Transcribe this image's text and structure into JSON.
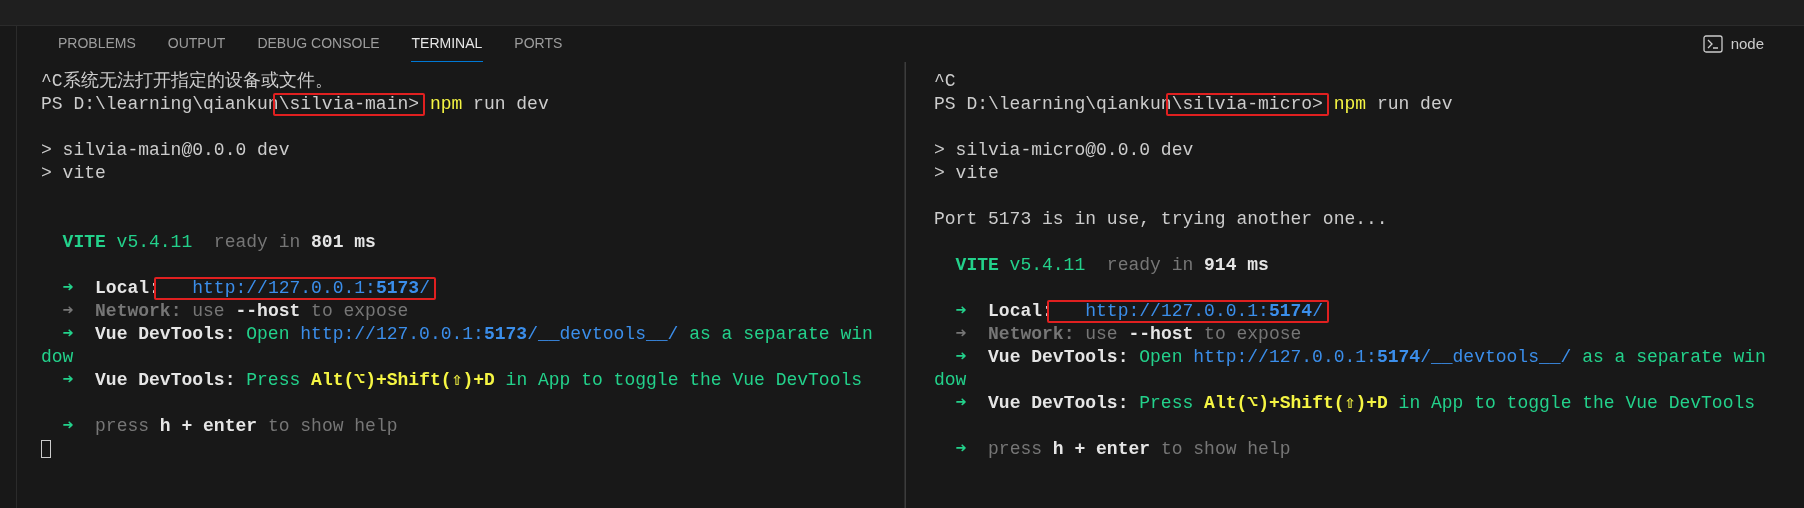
{
  "tabs": [
    {
      "label": "PROBLEMS",
      "selected": false
    },
    {
      "label": "OUTPUT",
      "selected": false
    },
    {
      "label": "DEBUG CONSOLE",
      "selected": false
    },
    {
      "label": "TERMINAL",
      "selected": true
    },
    {
      "label": "PORTS",
      "selected": false
    }
  ],
  "terminal_name": "node",
  "panes": [
    {
      "cursor_visible": true,
      "lines": [
        {
          "kind": "text",
          "segments": [
            {
              "text": "^C系统无法打开指定的设备或文件。",
              "kind": "text"
            }
          ]
        },
        {
          "kind": "text",
          "segments": [
            {
              "text": "PS D:\\learning\\qiankun",
              "kind": "text"
            },
            {
              "text": "\\silvia-main>",
              "kind": "text",
              "highlighted": true
            },
            {
              "text": " npm",
              "kind": "command"
            },
            {
              "text": " run dev",
              "kind": "text"
            }
          ]
        },
        {
          "kind": "blank"
        },
        {
          "kind": "text",
          "segments": [
            {
              "text": "> silvia-main@0.0.0 dev",
              "kind": "text"
            }
          ]
        },
        {
          "kind": "text",
          "segments": [
            {
              "text": "> vite",
              "kind": "text"
            }
          ]
        },
        {
          "kind": "blank"
        },
        {
          "kind": "blank"
        },
        {
          "kind": "indented",
          "segments": [
            {
              "text": "VITE",
              "kind": "accent-strong"
            },
            {
              "text": " v5.4.11",
              "kind": "accent"
            },
            {
              "text": "  ready in ",
              "kind": "muted"
            },
            {
              "text": "801 ms",
              "kind": "strong"
            }
          ]
        },
        {
          "kind": "blank"
        },
        {
          "kind": "indented",
          "segments": [
            {
              "text": "➜",
              "kind": "accent-strong"
            },
            {
              "text": "  Local:",
              "kind": "strong"
            },
            {
              "text": "   http://127.0.0.1:**5173**/",
              "kind": "link",
              "highlighted": true
            }
          ]
        },
        {
          "kind": "indented",
          "segments": [
            {
              "text": "➜",
              "kind": "muted-strong"
            },
            {
              "text": "  Network:",
              "kind": "muted-strong"
            },
            {
              "text": " use ",
              "kind": "muted"
            },
            {
              "text": "--host",
              "kind": "strong"
            },
            {
              "text": " to expose",
              "kind": "muted"
            }
          ]
        },
        {
          "kind": "indented",
          "segments": [
            {
              "text": "➜",
              "kind": "accent-strong"
            },
            {
              "text": "  Vue DevTools:",
              "kind": "strong"
            },
            {
              "text": " Open ",
              "kind": "accent"
            },
            {
              "text": "http://127.0.0.1:**5173**/__devtools__/",
              "kind": "link"
            },
            {
              "text": " as a separate win",
              "kind": "accent"
            }
          ]
        },
        {
          "kind": "text",
          "segments": [
            {
              "text": "dow",
              "kind": "accent"
            }
          ]
        },
        {
          "kind": "indented",
          "segments": [
            {
              "text": "➜",
              "kind": "accent-strong"
            },
            {
              "text": "  Vue DevTools:",
              "kind": "strong"
            },
            {
              "text": " Press ",
              "kind": "accent"
            },
            {
              "text": "Alt(⌥)+Shift(⇧)+D",
              "kind": "shortcut"
            },
            {
              "text": " in App to toggle the Vue DevTools",
              "kind": "accent"
            }
          ]
        },
        {
          "kind": "blank"
        },
        {
          "kind": "indented",
          "segments": [
            {
              "text": "➜",
              "kind": "accent-strong"
            },
            {
              "text": "  press ",
              "kind": "muted"
            },
            {
              "text": "h + enter",
              "kind": "strong"
            },
            {
              "text": " to show help",
              "kind": "muted"
            }
          ]
        }
      ]
    },
    {
      "lines": [
        {
          "kind": "text",
          "segments": [
            {
              "text": "^C",
              "kind": "text"
            }
          ]
        },
        {
          "kind": "text",
          "segments": [
            {
              "text": "PS D:\\learning\\qiankun",
              "kind": "text"
            },
            {
              "text": "\\silvia-micro>",
              "kind": "text",
              "highlighted": true
            },
            {
              "text": " npm",
              "kind": "command"
            },
            {
              "text": " run dev",
              "kind": "text"
            }
          ]
        },
        {
          "kind": "blank"
        },
        {
          "kind": "text",
          "segments": [
            {
              "text": "> silvia-micro@0.0.0 dev",
              "kind": "text"
            }
          ]
        },
        {
          "kind": "text",
          "segments": [
            {
              "text": "> vite",
              "kind": "text"
            }
          ]
        },
        {
          "kind": "blank"
        },
        {
          "kind": "text",
          "segments": [
            {
              "text": "Port 5173 is in use, trying another one...",
              "kind": "text"
            }
          ]
        },
        {
          "kind": "blank"
        },
        {
          "kind": "indented",
          "segments": [
            {
              "text": "VITE",
              "kind": "accent-strong"
            },
            {
              "text": " v5.4.11",
              "kind": "accent"
            },
            {
              "text": "  ready in ",
              "kind": "muted"
            },
            {
              "text": "914 ms",
              "kind": "strong"
            }
          ]
        },
        {
          "kind": "blank"
        },
        {
          "kind": "indented",
          "segments": [
            {
              "text": "➜",
              "kind": "accent-strong"
            },
            {
              "text": "  Local:",
              "kind": "strong"
            },
            {
              "text": "   http://127.0.0.1:**5174**/",
              "kind": "link",
              "highlighted": true
            }
          ]
        },
        {
          "kind": "indented",
          "segments": [
            {
              "text": "➜",
              "kind": "muted-strong"
            },
            {
              "text": "  Network:",
              "kind": "muted-strong"
            },
            {
              "text": " use ",
              "kind": "muted"
            },
            {
              "text": "--host",
              "kind": "strong"
            },
            {
              "text": " to expose",
              "kind": "muted"
            }
          ]
        },
        {
          "kind": "indented",
          "segments": [
            {
              "text": "➜",
              "kind": "accent-strong"
            },
            {
              "text": "  Vue DevTools:",
              "kind": "strong"
            },
            {
              "text": " Open ",
              "kind": "accent"
            },
            {
              "text": "http://127.0.0.1:**5174**/__devtools__/",
              "kind": "link"
            },
            {
              "text": " as a separate win",
              "kind": "accent"
            }
          ]
        },
        {
          "kind": "text",
          "segments": [
            {
              "text": "dow",
              "kind": "accent"
            }
          ]
        },
        {
          "kind": "indented",
          "segments": [
            {
              "text": "➜",
              "kind": "accent-strong"
            },
            {
              "text": "  Vue DevTools:",
              "kind": "strong"
            },
            {
              "text": " Press ",
              "kind": "accent"
            },
            {
              "text": "Alt(⌥)+Shift(⇧)+D",
              "kind": "shortcut"
            },
            {
              "text": " in App to toggle the Vue DevTools",
              "kind": "accent"
            }
          ]
        },
        {
          "kind": "blank"
        },
        {
          "kind": "indented",
          "segments": [
            {
              "text": "➜",
              "kind": "accent-strong"
            },
            {
              "text": "  press ",
              "kind": "muted"
            },
            {
              "text": "h + enter",
              "kind": "strong"
            },
            {
              "text": " to show help",
              "kind": "muted"
            }
          ]
        }
      ]
    }
  ]
}
